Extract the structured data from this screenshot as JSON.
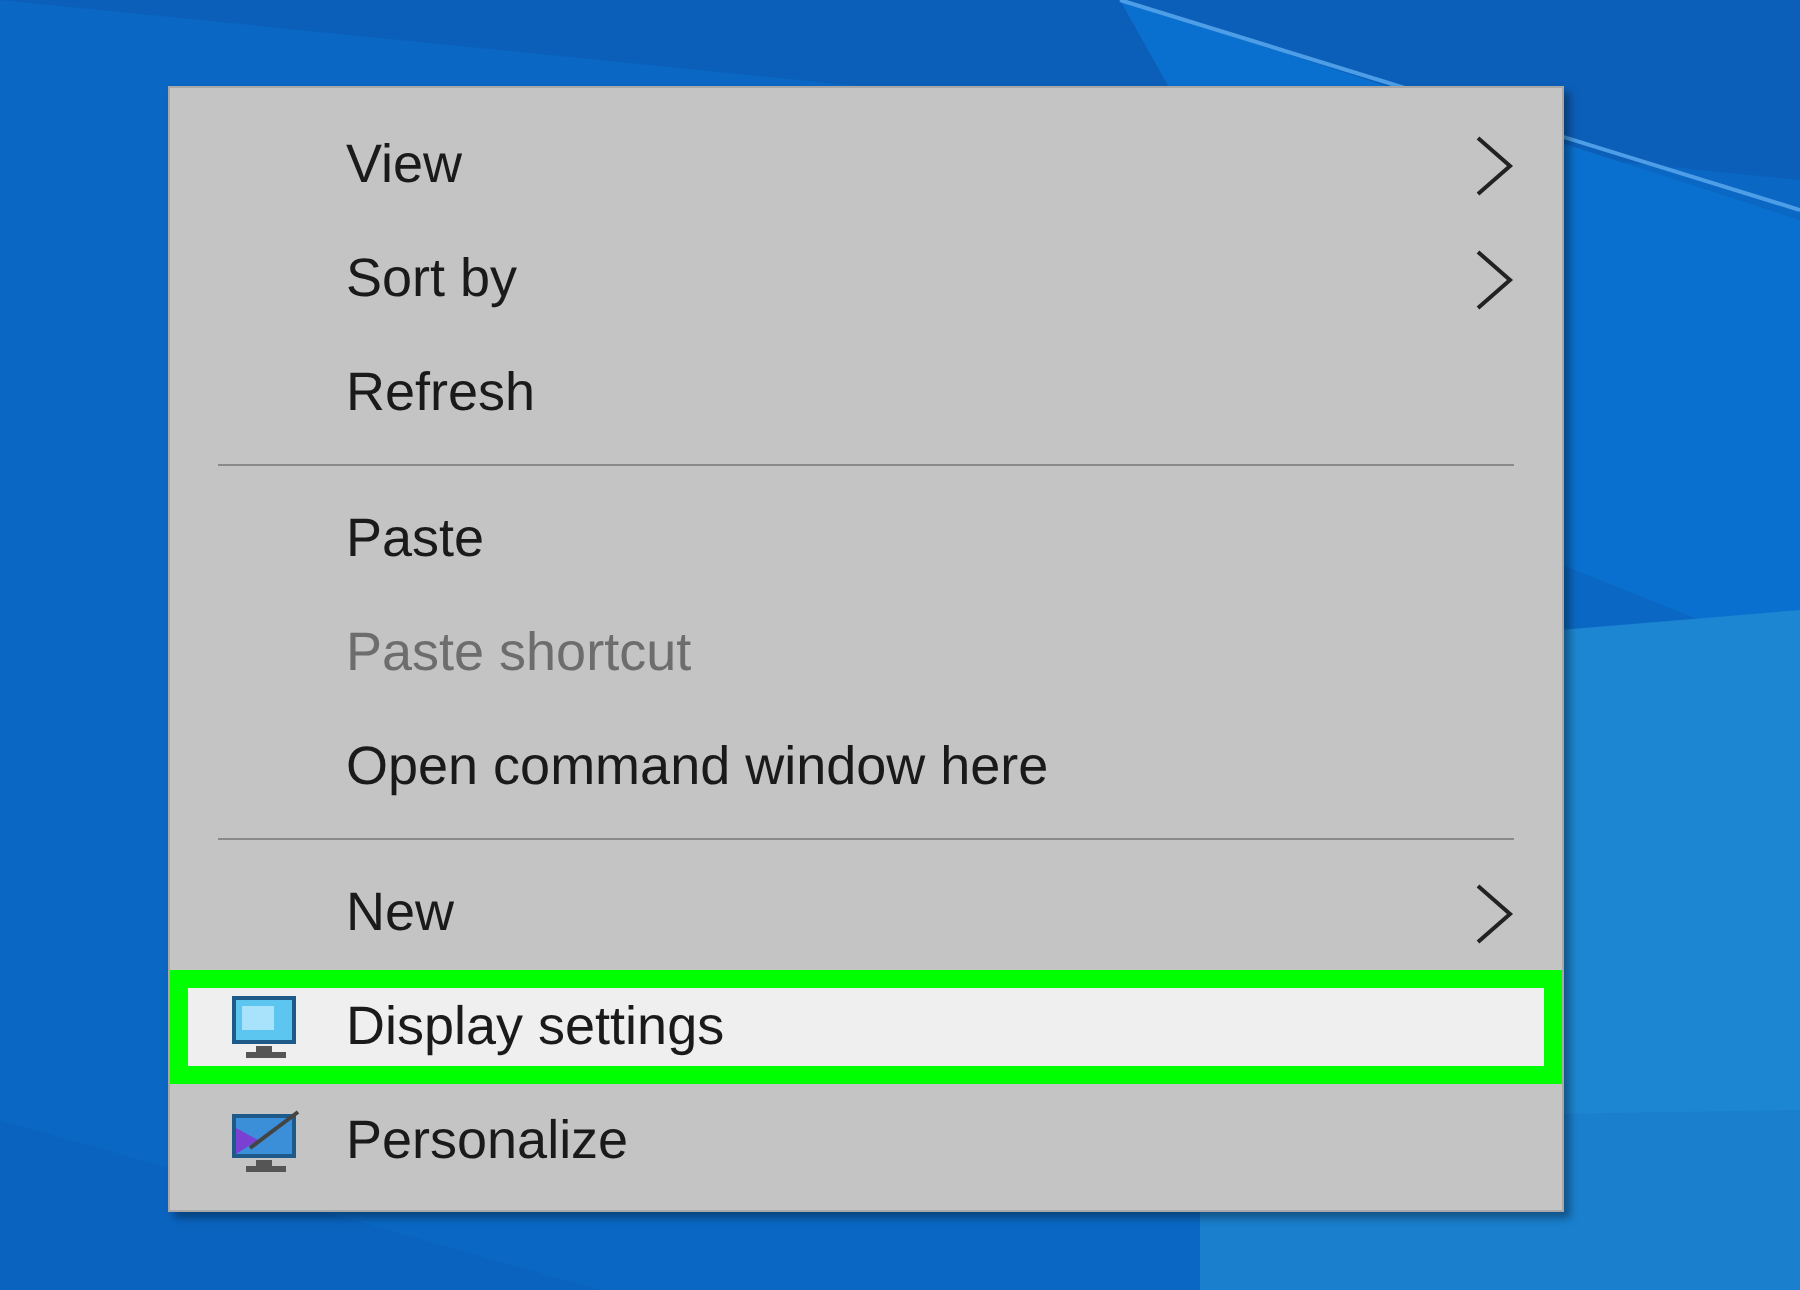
{
  "context_menu": {
    "items": [
      {
        "kind": "item",
        "label": "View",
        "disabled": false,
        "submenu": true,
        "selected": false
      },
      {
        "kind": "item",
        "label": "Sort by",
        "disabled": false,
        "submenu": true,
        "selected": false
      },
      {
        "kind": "item",
        "label": "Refresh",
        "disabled": false,
        "submenu": false,
        "selected": false
      },
      {
        "kind": "separator"
      },
      {
        "kind": "item",
        "label": "Paste",
        "disabled": false,
        "submenu": false,
        "selected": false
      },
      {
        "kind": "item",
        "label": "Paste shortcut",
        "disabled": true,
        "submenu": false,
        "selected": false
      },
      {
        "kind": "item",
        "label": "Open command window here",
        "disabled": false,
        "submenu": false,
        "selected": false
      },
      {
        "kind": "separator"
      },
      {
        "kind": "item",
        "label": "New",
        "disabled": false,
        "submenu": true,
        "selected": false
      },
      {
        "kind": "item",
        "label": "Display settings",
        "disabled": false,
        "submenu": false,
        "selected": true
      },
      {
        "kind": "item",
        "label": "Personalize",
        "disabled": false,
        "submenu": false,
        "selected": false
      }
    ]
  }
}
